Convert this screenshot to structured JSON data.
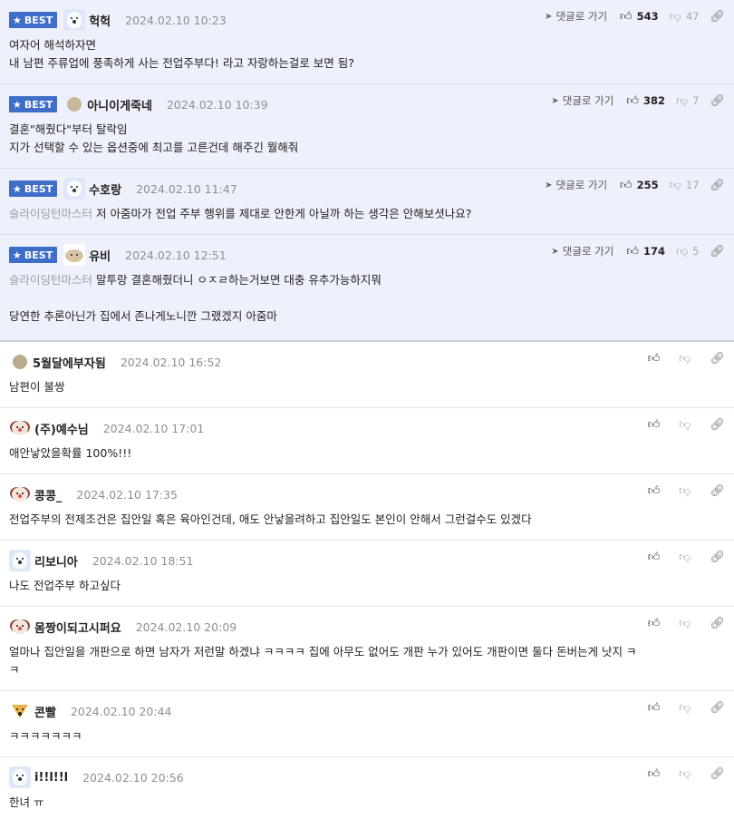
{
  "best_label": "BEST",
  "reply_label": "댓글로 가기",
  "comments": [
    {
      "nick": "헉헉",
      "date": "2024.02.10 10:23",
      "likes": "543",
      "hates": "47",
      "avatar": "bear-icon",
      "lines": [
        "여자어 해석하자면",
        "내 남편 주류업에 풍족하게 사는 전업주부다! 라고 자랑하는걸로 보면 됨?"
      ]
    },
    {
      "nick": "아니이게죽네",
      "date": "2024.02.10 10:39",
      "likes": "382",
      "hates": "7",
      "avatar": "dot-icon",
      "lines": [
        "결혼\"해줬다\"부터 탈락임",
        "지가 선택할 수 있는 옵션중에 최고를 고른건데 해주긴 뭘해줘"
      ]
    },
    {
      "nick": "수호랑",
      "date": "2024.02.10 11:47",
      "likes": "255",
      "hates": "17",
      "avatar": "bear-icon",
      "mention": "슬라이딩턴마스터",
      "lines": [
        "저 아줌마가 전업 주부 행위를 제대로 안한게 아닐까 하는 생각은 안해보셧나요?"
      ]
    },
    {
      "nick": "유비",
      "date": "2024.02.10 12:51",
      "likes": "174",
      "hates": "5",
      "avatar": "puppy-icon",
      "mention": "슬라이딩턴마스터",
      "lines": [
        "말투랑 결혼해줬더니 ㅇㅈㄹ하는거보면 대충 유추가능하지뭐",
        "",
        "당연한 추론아닌가 집에서 존나게노니깐 그랬겠지 아줌마"
      ]
    },
    {
      "nick": "5월달에부자됨",
      "date": "2024.02.10 16:52",
      "avatar": "dot-icon",
      "lines": [
        "남편이 불쌍"
      ]
    },
    {
      "nick": "(주)예수님",
      "date": "2024.02.10 17:01",
      "avatar": "dog-icon",
      "lines": [
        "애안낳았을확률 100%!!!"
      ]
    },
    {
      "nick": "콩콩_",
      "date": "2024.02.10 17:35",
      "avatar": "dog-icon",
      "lines": [
        "전업주부의 전제조건은 집안일 혹은 육아인건데, 애도 안낳을려하고 집안일도 본인이 안해서 그런걸수도 있겠다"
      ]
    },
    {
      "nick": "리보니아",
      "date": "2024.02.10 18:51",
      "avatar": "bear-icon",
      "lines": [
        "나도 전업주부 하고싶다"
      ]
    },
    {
      "nick": "몸짱이되고시퍼요",
      "date": "2024.02.10 20:09",
      "avatar": "dog-icon",
      "lines": [
        "얼마나 집안일을 개판으로 하면 남자가 저런말 하겠냐 ㅋㅋㅋㅋ 집에 아무도 없어도 개판 누가 있어도 개판이면 둘다 돈버는게 낫지 ㅋ",
        "ㅋ"
      ]
    },
    {
      "nick": "콘빨",
      "date": "2024.02.10 20:44",
      "avatar": "fox-icon",
      "lines": [
        "ㅋㅋㅋㅋㅋㅋㅋ"
      ]
    },
    {
      "nick": "i!!l!!l",
      "date": "2024.02.10 20:56",
      "avatar": "bear-icon",
      "lines": [
        "한녀 ㅠ"
      ]
    }
  ]
}
